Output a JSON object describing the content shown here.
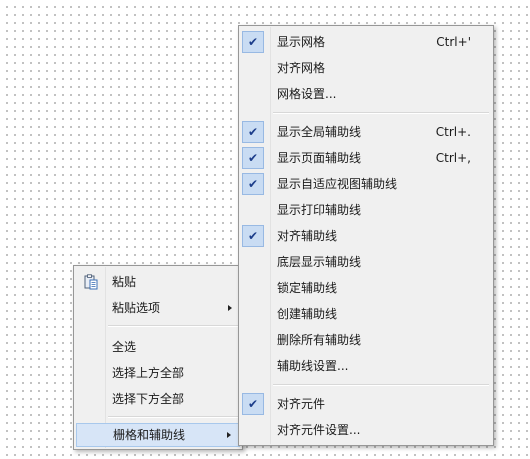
{
  "context_menu": {
    "items": [
      {
        "label": "粘贴",
        "icon": "clipboard-paste-icon"
      },
      {
        "label": "粘贴选项",
        "submenu": true
      },
      {
        "label": "全选"
      },
      {
        "label": "选择上方全部"
      },
      {
        "label": "选择下方全部"
      },
      {
        "label": "栅格和辅助线",
        "submenu": true,
        "highlighted": true
      }
    ]
  },
  "submenu": {
    "items": [
      {
        "label": "显示网格",
        "checked": true,
        "shortcut": "Ctrl+'"
      },
      {
        "label": "对齐网格",
        "checked": false
      },
      {
        "label": "网格设置...",
        "checked": false
      },
      {
        "label": "显示全局辅助线",
        "checked": true,
        "shortcut": "Ctrl+."
      },
      {
        "label": "显示页面辅助线",
        "checked": true,
        "shortcut": "Ctrl+,"
      },
      {
        "label": "显示自适应视图辅助线",
        "checked": true
      },
      {
        "label": "显示打印辅助线",
        "checked": false
      },
      {
        "label": "对齐辅助线",
        "checked": true
      },
      {
        "label": "底层显示辅助线",
        "checked": false
      },
      {
        "label": "锁定辅助线",
        "checked": false
      },
      {
        "label": "创建辅助线",
        "checked": false
      },
      {
        "label": "删除所有辅助线",
        "checked": false
      },
      {
        "label": "辅助线设置...",
        "checked": false
      },
      {
        "label": "对齐元件",
        "checked": true
      },
      {
        "label": "对齐元件设置...",
        "checked": false
      }
    ]
  },
  "colors": {
    "highlight": "#d7e5f7",
    "check": "#1c3d8a",
    "menu_bg": "#f0f0f0"
  }
}
